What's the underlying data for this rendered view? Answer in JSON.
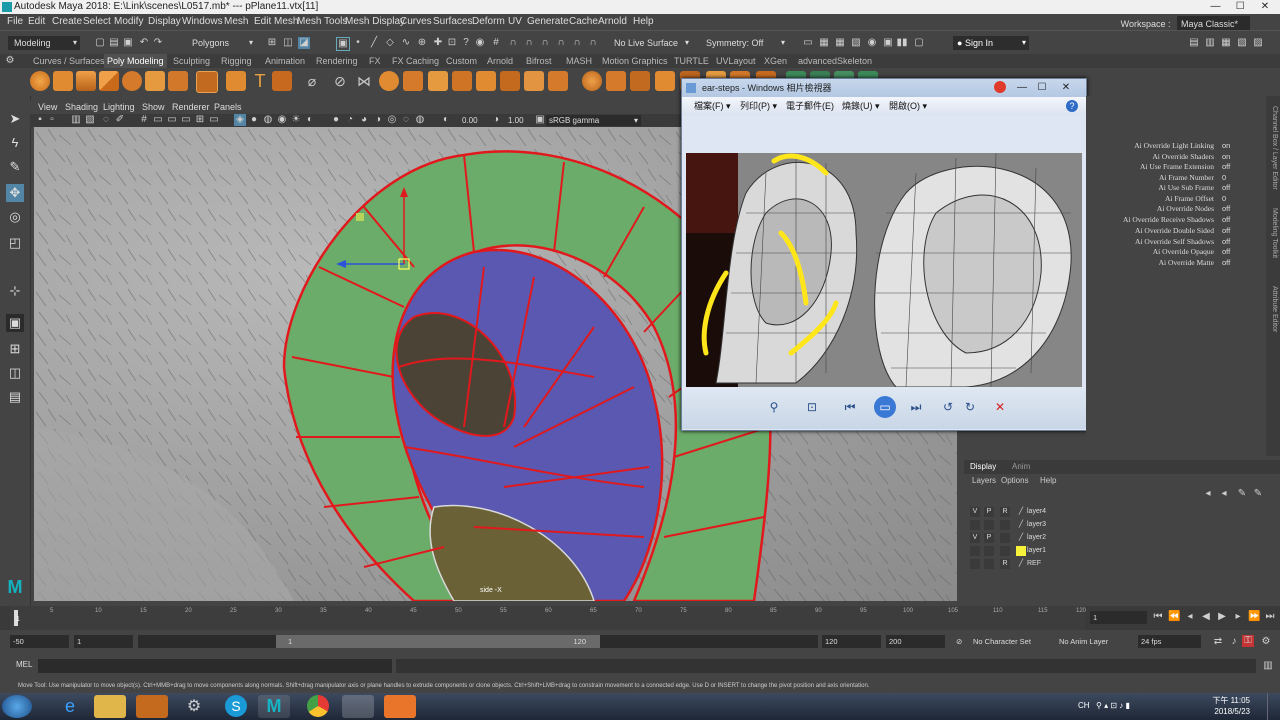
{
  "window": {
    "title": "Autodesk Maya 2018: E:\\Link\\scenes\\L0517.mb* --- pPlane11.vtx[11]",
    "controls": [
      "—",
      "☐",
      "✕"
    ]
  },
  "menubar": {
    "items": [
      "File",
      "Edit",
      "Create",
      "Select",
      "Modify",
      "Display",
      "Windows",
      "Mesh",
      "Edit Mesh",
      "Mesh Tools",
      "Mesh Display",
      "Curves",
      "Surfaces",
      "Deform",
      "UV",
      "Generate",
      "Cache",
      "Arnold",
      "Help"
    ],
    "workspace_label": "Workspace :",
    "workspace_value": "Maya Classic*"
  },
  "statusline": {
    "menuset": "Modeling",
    "selection_mode": "Polygons",
    "live_surface": "No Live Surface",
    "symmetry": "Symmetry: Off",
    "signin": "Sign In"
  },
  "shelf": {
    "tabs": [
      "Curves / Surfaces",
      "Poly Modeling",
      "Sculpting",
      "Rigging",
      "Animation",
      "Rendering",
      "FX",
      "FX Caching",
      "Custom",
      "Arnold",
      "Bifrost",
      "MASH",
      "Motion Graphics",
      "TURTLE",
      "UVLayout",
      "XGen",
      "advancedSkeleton"
    ],
    "active_tab": "Poly Modeling"
  },
  "viewport": {
    "menu": [
      "View",
      "Shading",
      "Lighting",
      "Show",
      "Renderer",
      "Panels"
    ],
    "near_value": "0.00",
    "far_value": "1.00",
    "color_space": "sRGB gamma",
    "camera_label": "side -X"
  },
  "photo_viewer": {
    "title": "ear-steps - Windows 相片檢視器",
    "menu": [
      "檔案(F) ▾",
      "列印(P) ▾",
      "電子郵件(E)",
      "燒錄(U) ▾",
      "開啟(O) ▾"
    ]
  },
  "channel_box": {
    "attributes": [
      {
        "name": "Ai Override Light Linking",
        "value": "on"
      },
      {
        "name": "Ai Override Shaders",
        "value": "on"
      },
      {
        "name": "Ai Use Frame Extension",
        "value": "off"
      },
      {
        "name": "Ai Frame Number",
        "value": "0"
      },
      {
        "name": "Ai Use Sub Frame",
        "value": "off"
      },
      {
        "name": "Ai Frame Offset",
        "value": "0"
      },
      {
        "name": "Ai Override Nodes",
        "value": "off"
      },
      {
        "name": "Ai Override Receive Shadows",
        "value": "off"
      },
      {
        "name": "Ai Override Double Sided",
        "value": "off"
      },
      {
        "name": "Ai Override Self Shadows",
        "value": "off"
      },
      {
        "name": "Ai Override Opaque",
        "value": "off"
      },
      {
        "name": "Ai Override Matte",
        "value": "off"
      }
    ],
    "side_tabs": [
      "Channel Box / Layer Editor",
      "Modeling Toolkit",
      "Attribute Editor"
    ]
  },
  "layer_editor": {
    "tabs": [
      "Display",
      "Anim"
    ],
    "menu": [
      "Layers",
      "Options",
      "Help"
    ],
    "layers": [
      {
        "v": "V",
        "p": "P",
        "r": "R",
        "name": "layer4",
        "color": ""
      },
      {
        "v": "",
        "p": "",
        "r": "",
        "name": "layer3",
        "color": ""
      },
      {
        "v": "V",
        "p": "P",
        "r": "",
        "name": "layer2",
        "color": ""
      },
      {
        "v": "",
        "p": "",
        "r": "",
        "name": "layer1",
        "color": "#f7f23a"
      },
      {
        "v": "",
        "p": "",
        "r": "R",
        "name": "REF",
        "color": ""
      }
    ]
  },
  "timeslider": {
    "ticks": [
      "1",
      "5",
      "10",
      "15",
      "20",
      "25",
      "30",
      "35",
      "40",
      "45",
      "50",
      "55",
      "60",
      "65",
      "70",
      "75",
      "80",
      "85",
      "90",
      "95",
      "100",
      "105",
      "110",
      "115",
      "120"
    ],
    "current_frame": "1"
  },
  "range": {
    "start_outer": "-50",
    "start_inner": "1",
    "slider_start": "1",
    "slider_end": "120",
    "end_inner": "120",
    "end_outer": "200",
    "character_set": "No Character Set",
    "anim_layer": "No Anim Layer",
    "fps": "24 fps"
  },
  "command_line": {
    "lang": "MEL"
  },
  "help_line": "Move Tool: Use manipulator to move object(s). Ctrl+MMB+drag to move components along normals. Shift+drag manipulator axis or plane handles to extrude components or clone objects. Ctrl+Shift+LMB+drag to constrain movement to a connected edge. Use D or INSERT to change the pivot position and axis orientation.",
  "taskbar": {
    "ime": "CH",
    "time": "下午 11:05",
    "date": "2018/5/23"
  }
}
